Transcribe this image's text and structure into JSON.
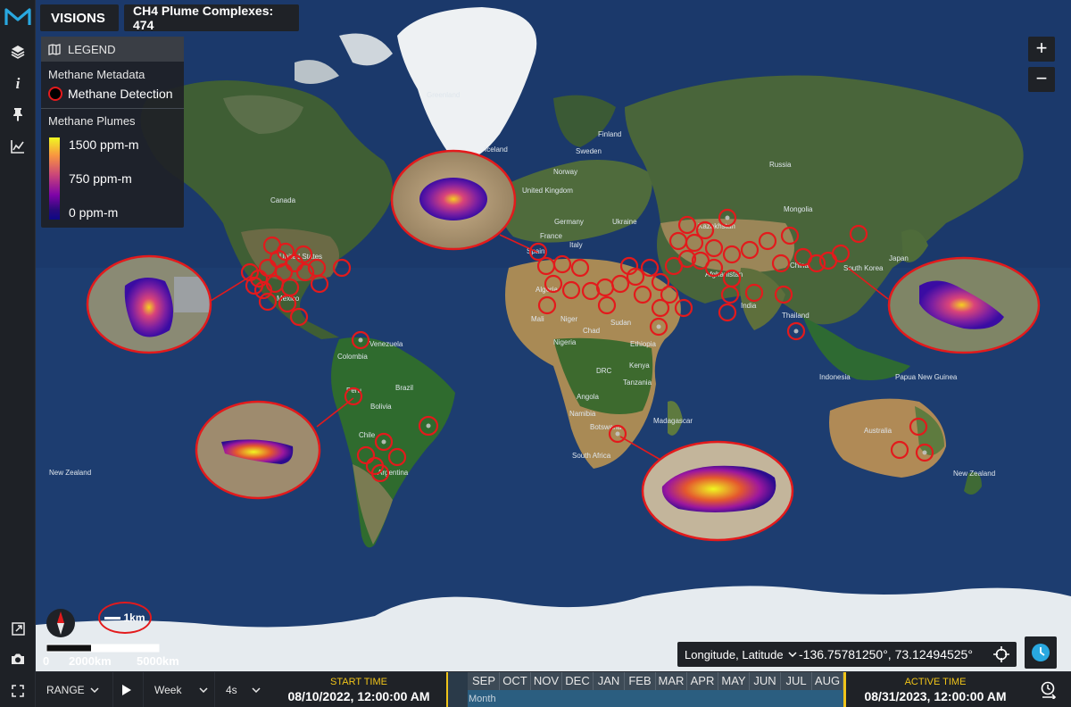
{
  "app": {
    "title": "VISIONS",
    "count_label": "CH4 Plume Complexes: 474"
  },
  "legend": {
    "title": "LEGEND",
    "metadata_title": "Methane Metadata",
    "detection_label": "Methane Detection",
    "plumes_title": "Methane Plumes",
    "ramp_max": "1500 ppm-m",
    "ramp_mid": "750 ppm-m",
    "ramp_min": "0 ppm-m"
  },
  "map": {
    "labels": {
      "greenland": "Greenland",
      "iceland": "Iceland",
      "finland": "Finland",
      "norway": "Norway",
      "sweden": "Sweden",
      "russia": "Russia",
      "united_kingdom": "United Kingdom",
      "germany": "Germany",
      "ukraine": "Ukraine",
      "france": "France",
      "italy": "Italy",
      "spain": "Spain",
      "mongolia": "Mongolia",
      "kazakhstan": "Kazakhstan",
      "afghanistan": "Afghanistan",
      "china": "China",
      "south_korea": "South Korea",
      "japan": "Japan",
      "india": "India",
      "thailand": "Thailand",
      "indonesia": "Indonesia",
      "papua_new_guinea": "Papua New Guinea",
      "australia": "Australia",
      "new_zealand_east": "New Zealand",
      "new_zealand_west": "New Zealand",
      "canada": "Canada",
      "united_states": "United States",
      "mexico": "Mexico",
      "venezuela": "Venezuela",
      "colombia": "Colombia",
      "peru": "Peru",
      "brazil": "Brazil",
      "bolivia": "Bolivia",
      "chile": "Chile",
      "argentina": "Argentina",
      "algeria": "Algeria",
      "mali": "Mali",
      "niger": "Niger",
      "chad": "Chad",
      "sudan": "Sudan",
      "nigeria": "Nigeria",
      "ethiopia": "Ethiopia",
      "drc": "DRC",
      "kenya": "Kenya",
      "tanzania": "Tanzania",
      "angola": "Angola",
      "namibia": "Namibia",
      "botswana": "Botswana",
      "madagascar": "Madagascar",
      "south_africa": "South Africa"
    }
  },
  "controls": {
    "zoom_in": "+",
    "zoom_out": "−"
  },
  "coords": {
    "label": "Longitude, Latitude",
    "value": "-136.75781250°, 73.12494525°"
  },
  "scale": {
    "zero": "0",
    "mid": "2000km",
    "max": "5000km",
    "inset": "1km"
  },
  "timeline": {
    "mode": "RANGE",
    "step": "Week",
    "speed": "4s",
    "start_header": "START TIME",
    "start_value": "08/10/2022, 12:00:00 AM",
    "months": [
      "SEP",
      "OCT",
      "NOV",
      "DEC",
      "JAN",
      "FEB",
      "MAR",
      "APR",
      "MAY",
      "JUN",
      "JUL",
      "AUG"
    ],
    "sub_label": "Month",
    "active_header": "ACTIVE TIME",
    "active_value": "08/31/2023, 12:00:00 AM"
  },
  "colors": {
    "accent": "#f0c419",
    "detection_ring": "#e31a1c",
    "ocean": "#1c3a6b",
    "panel": "#1f2227"
  }
}
